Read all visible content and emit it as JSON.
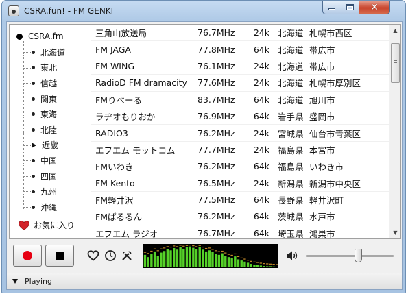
{
  "window": {
    "title": "CSRA.fun! - FM GENKI"
  },
  "tree": {
    "root": "CSRA.fm",
    "items": [
      {
        "label": "北海道",
        "expanded": false
      },
      {
        "label": "東北",
        "expanded": false
      },
      {
        "label": "信越",
        "expanded": false
      },
      {
        "label": "関東",
        "expanded": false
      },
      {
        "label": "東海",
        "expanded": false
      },
      {
        "label": "北陸",
        "expanded": false
      },
      {
        "label": "近畿",
        "expanded": true
      },
      {
        "label": "中国",
        "expanded": false
      },
      {
        "label": "四国",
        "expanded": false
      },
      {
        "label": "九州",
        "expanded": false
      },
      {
        "label": "沖縄",
        "expanded": false
      }
    ],
    "favorites": "お気に入り"
  },
  "stations": [
    {
      "name": "三角山放送局",
      "freq": "76.7MHz",
      "rate": "24k",
      "pref": "北海道",
      "city": "札幌市西区"
    },
    {
      "name": "FM JAGA",
      "freq": "77.8MHz",
      "rate": "64k",
      "pref": "北海道",
      "city": "帯広市"
    },
    {
      "name": "FM WING",
      "freq": "76.1MHz",
      "rate": "24k",
      "pref": "北海道",
      "city": "帯広市"
    },
    {
      "name": "RadioD FM dramacity",
      "freq": "77.6MHz",
      "rate": "24k",
      "pref": "北海道",
      "city": "札幌市厚別区"
    },
    {
      "name": "FMりべーる",
      "freq": "83.7MHz",
      "rate": "64k",
      "pref": "北海道",
      "city": "旭川市"
    },
    {
      "name": "ラヂオもりおか",
      "freq": "76.9MHz",
      "rate": "64k",
      "pref": "岩手県",
      "city": "盛岡市"
    },
    {
      "name": "RADIO3",
      "freq": "76.2MHz",
      "rate": "24k",
      "pref": "宮城県",
      "city": "仙台市青葉区"
    },
    {
      "name": "エフエム モットコム",
      "freq": "77.7MHz",
      "rate": "24k",
      "pref": "福島県",
      "city": "本宮市"
    },
    {
      "name": "FMいわき",
      "freq": "76.2MHz",
      "rate": "64k",
      "pref": "福島県",
      "city": "いわき市"
    },
    {
      "name": "FM Kento",
      "freq": "76.5MHz",
      "rate": "24k",
      "pref": "新潟県",
      "city": "新潟市中央区"
    },
    {
      "name": "FM軽井沢",
      "freq": "77.5MHz",
      "rate": "64k",
      "pref": "長野県",
      "city": "軽井沢町"
    },
    {
      "name": "FMぱるるん",
      "freq": "76.2MHz",
      "rate": "64k",
      "pref": "茨城県",
      "city": "水戸市"
    },
    {
      "name": "エフエム ラジオ",
      "freq": "76.7MHz",
      "rate": "64k",
      "pref": "埼玉県",
      "city": "鴻巣市"
    }
  ],
  "controls": {
    "record_icon": "record-icon",
    "stop_icon": "stop-icon",
    "favorite_icon": "heart-outline-icon",
    "timer_icon": "clock-icon",
    "settings_icon": "tools-icon",
    "volume_icon": "speaker-icon",
    "volume_level": 0.62,
    "spectrum_levels": [
      0.55,
      0.45,
      0.6,
      0.7,
      0.5,
      0.65,
      0.72,
      0.8,
      0.75,
      0.85,
      0.78,
      0.9,
      0.82,
      0.88,
      0.92,
      0.86,
      0.8,
      0.9,
      0.78,
      0.7,
      0.75,
      0.68,
      0.6,
      0.55,
      0.62,
      0.5,
      0.45,
      0.4,
      0.48,
      0.35,
      0.3,
      0.25,
      0.2,
      0.15,
      0.12,
      0.1,
      0.08,
      0.06,
      0.05,
      0.05,
      0.04,
      0.03
    ],
    "spectrum_peaks": [
      0.65,
      0.6,
      0.7,
      0.8,
      0.72,
      0.8,
      0.84,
      0.9,
      0.88,
      0.93,
      0.9,
      0.96,
      0.92,
      0.95,
      0.97,
      0.94,
      0.9,
      0.95,
      0.88,
      0.82,
      0.84,
      0.78,
      0.72,
      0.68,
      0.7,
      0.62,
      0.56,
      0.52,
      0.58,
      0.46,
      0.4,
      0.35,
      0.3,
      0.25,
      0.22,
      0.2,
      0.17,
      0.15,
      0.14,
      0.13,
      0.12,
      0.11
    ],
    "colors": {
      "record": "#e60012",
      "bar": "#55d128",
      "peak": "#c58a2a"
    }
  },
  "status": {
    "text": "Playing"
  }
}
